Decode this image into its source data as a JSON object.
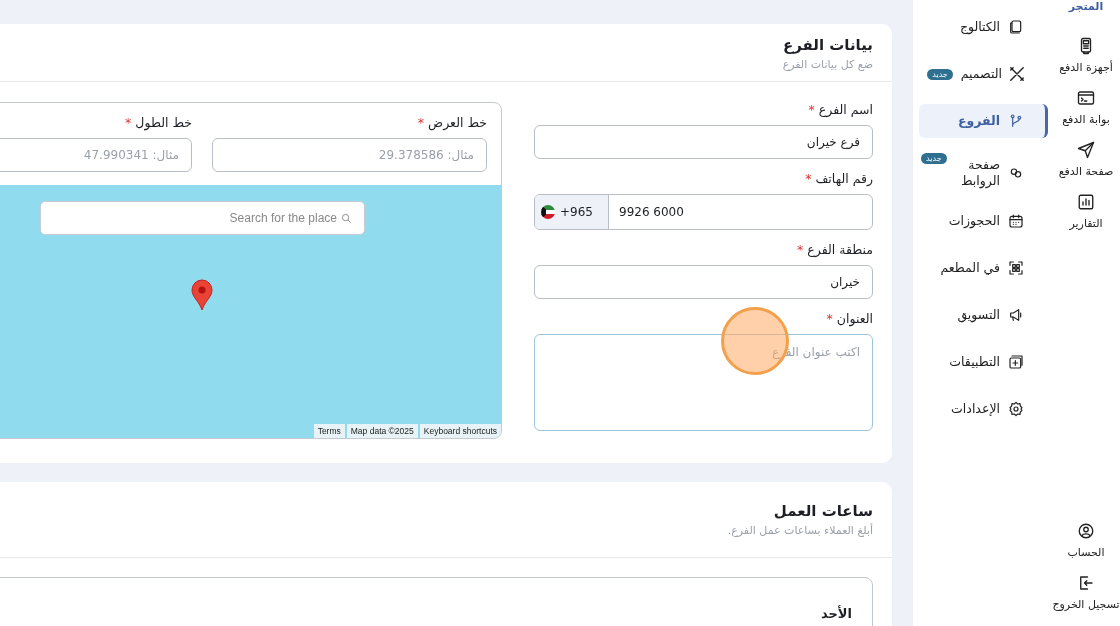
{
  "rail": {
    "items": [
      {
        "label": "المتجر",
        "selected": true
      },
      {
        "label": "أجهزة الدفع",
        "selected": false
      },
      {
        "label": "بوابة الدفع",
        "selected": false
      },
      {
        "label": "صفحة الدفع",
        "selected": false
      },
      {
        "label": "التقارير",
        "selected": false
      }
    ],
    "bottom": [
      {
        "label": "الحساب"
      },
      {
        "label": "تسجيل الخروج"
      }
    ]
  },
  "sidebar": {
    "items": [
      {
        "label": "الكتالوج",
        "selected": false
      },
      {
        "label": "التصميم",
        "selected": false,
        "badge": "جديد"
      },
      {
        "label": "الفروع",
        "selected": true
      },
      {
        "label": "صفحة الروابط",
        "selected": false,
        "badge": "جديد"
      },
      {
        "label": "الحجوزات",
        "selected": false
      },
      {
        "label": "في المطعم",
        "selected": false
      },
      {
        "label": "التسويق",
        "selected": false
      },
      {
        "label": "التطبيقات",
        "selected": false
      },
      {
        "label": "الإعدادات",
        "selected": false
      }
    ]
  },
  "branch_card": {
    "title": "بيانات الفرع",
    "subtitle": "ضع كل بيانات الفرع",
    "fields": [
      {
        "kind": "text",
        "label": "اسم الفرع",
        "mark": "*",
        "value": "فرع خيران"
      },
      {
        "kind": "phone",
        "label": "رقم الهاتف",
        "mark": "*",
        "country_code": "+965",
        "value": "9926 6000"
      },
      {
        "kind": "text",
        "label": "منطقة الفرع",
        "mark": "*",
        "value": "خيران"
      },
      {
        "kind": "textarea",
        "label": "العنوان",
        "mark": "*",
        "placeholder": "اكتب عنوان الفرع"
      }
    ],
    "coordinates": [
      {
        "label": "خط العرض",
        "mark": "*",
        "placeholder": "مثال: 29.378586"
      },
      {
        "label": "خط الطول",
        "mark": "*",
        "placeholder": "مثال: 47.990341"
      }
    ],
    "map": {
      "search_placeholder": "Search for the place",
      "attribution": [
        "Keyboard shortcuts",
        "Map data ©2025",
        "Terms"
      ]
    }
  },
  "hours_card": {
    "title": "ساعات العمل",
    "subtitle": "أبلغ العملاء بساعات عمل الفرع.",
    "days": [
      "الأحد"
    ]
  }
}
